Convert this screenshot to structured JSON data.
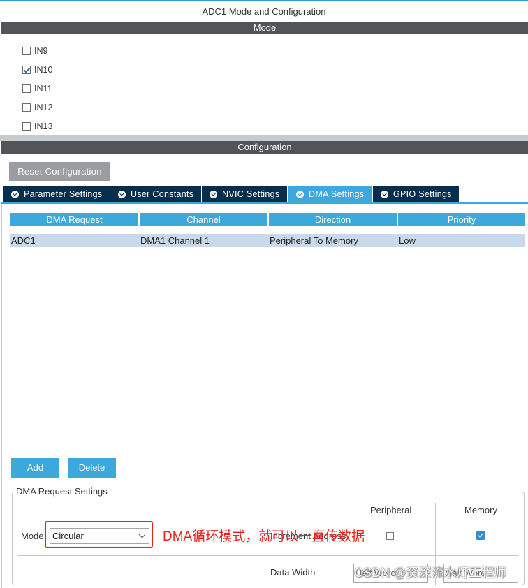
{
  "window": {
    "title": "ADC1 Mode and Configuration"
  },
  "mode_section": {
    "header": "Mode",
    "channels": [
      {
        "label": "IN9",
        "checked": false
      },
      {
        "label": "IN10",
        "checked": true
      },
      {
        "label": "IN11",
        "checked": false
      },
      {
        "label": "IN12",
        "checked": false
      },
      {
        "label": "IN13",
        "checked": false
      }
    ]
  },
  "config_section": {
    "header": "Configuration",
    "reset_button": "Reset Configuration",
    "tabs": [
      {
        "label": "Parameter Settings",
        "active": false
      },
      {
        "label": "User Constants",
        "active": false
      },
      {
        "label": "NVIC Settings",
        "active": false
      },
      {
        "label": "DMA Settings",
        "active": true
      },
      {
        "label": "GPIO Settings",
        "active": false
      }
    ]
  },
  "dma_table": {
    "columns": [
      "DMA Request",
      "Channel",
      "Direction",
      "Priority"
    ],
    "rows": [
      [
        "ADC1",
        "DMA1 Channel 1",
        "Peripheral To Memory",
        "Low"
      ]
    ]
  },
  "buttons": {
    "add": "Add",
    "delete": "Delete"
  },
  "request_settings": {
    "legend": "DMA Request Settings",
    "peripheral_header": "Peripheral",
    "memory_header": "Memory",
    "mode_label": "Mode",
    "mode_value": "Circular",
    "increment_label": "Increment Address",
    "peripheral_increment": false,
    "memory_increment": true,
    "data_width_label": "Data Width",
    "peripheral_width": "Half Word",
    "memory_width": "Half Word"
  },
  "annotation": "DMA循环模式，就可以一直传数据",
  "watermark": "CSDN @资深流水灯工程师",
  "colors": {
    "accent": "#3da8dc",
    "tab_inactive": "#082e4e",
    "section_bar": "#525558",
    "annotation_red": "#e8221b",
    "row_selected": "#c9d9ec"
  }
}
